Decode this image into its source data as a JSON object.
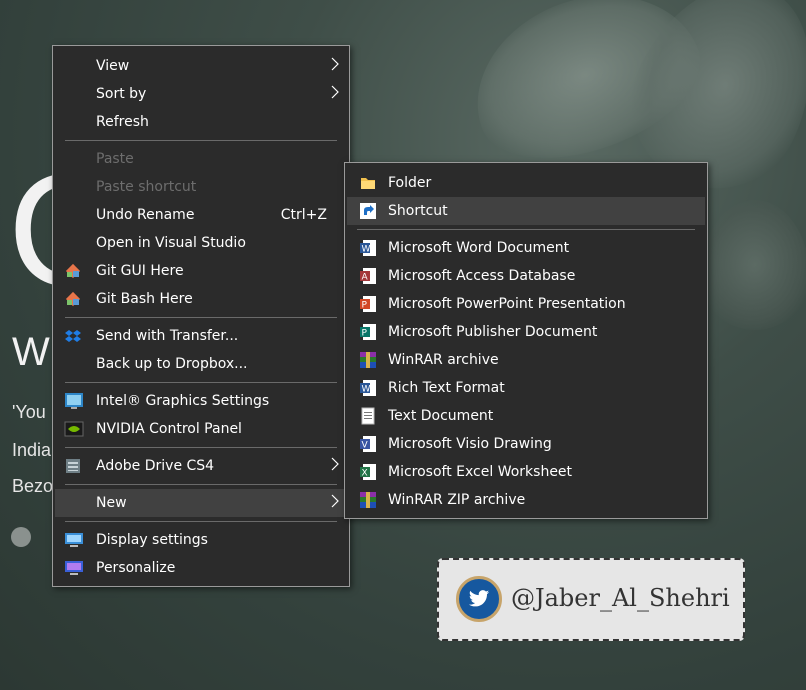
{
  "background": {
    "big_char": "O",
    "heading": "W",
    "lines": [
      "'You",
      "India",
      "Bezo"
    ]
  },
  "context_menu": {
    "items": [
      {
        "label": "View",
        "has_submenu": true
      },
      {
        "label": "Sort by",
        "has_submenu": true
      },
      {
        "label": "Refresh"
      },
      {
        "label": "Paste",
        "disabled": true
      },
      {
        "label": "Paste shortcut",
        "disabled": true
      },
      {
        "label": "Undo Rename",
        "accel": "Ctrl+Z"
      },
      {
        "label": "Open in Visual Studio"
      },
      {
        "label": "Git GUI Here",
        "icon": "git-gui-icon"
      },
      {
        "label": "Git Bash Here",
        "icon": "git-bash-icon"
      },
      {
        "label": "Send with Transfer...",
        "icon": "dropbox-icon"
      },
      {
        "label": "Back up to Dropbox..."
      },
      {
        "label": "Intel® Graphics Settings",
        "icon": "intel-graphics-icon"
      },
      {
        "label": "NVIDIA Control Panel",
        "icon": "nvidia-icon"
      },
      {
        "label": "Adobe Drive CS4",
        "icon": "adobe-drive-icon",
        "has_submenu": true
      },
      {
        "label": "New",
        "has_submenu": true,
        "highlighted": true
      },
      {
        "label": "Display settings",
        "icon": "display-icon"
      },
      {
        "label": "Personalize",
        "icon": "personalize-icon"
      }
    ]
  },
  "new_submenu": {
    "items": [
      {
        "label": "Folder",
        "icon": "folder-icon"
      },
      {
        "label": "Shortcut",
        "icon": "shortcut-icon",
        "highlighted": true
      },
      {
        "label": "Microsoft Word Document",
        "icon": "word-icon"
      },
      {
        "label": "Microsoft Access Database",
        "icon": "access-icon"
      },
      {
        "label": "Microsoft PowerPoint Presentation",
        "icon": "powerpoint-icon"
      },
      {
        "label": "Microsoft Publisher Document",
        "icon": "publisher-icon"
      },
      {
        "label": "WinRAR archive",
        "icon": "winrar-icon"
      },
      {
        "label": "Rich Text Format",
        "icon": "rtf-icon"
      },
      {
        "label": "Text Document",
        "icon": "text-document-icon"
      },
      {
        "label": "Microsoft Visio Drawing",
        "icon": "visio-icon"
      },
      {
        "label": "Microsoft Excel Worksheet",
        "icon": "excel-icon"
      },
      {
        "label": "WinRAR ZIP archive",
        "icon": "winrar-zip-icon"
      }
    ]
  },
  "watermark": {
    "handle": "@Jaber_Al_Shehri",
    "icon": "twitter-icon"
  },
  "colors": {
    "menu_bg": "#2b2b2b",
    "menu_highlight": "#414141",
    "disabled_text": "#6d6d6d",
    "twitter_blue": "#16589f"
  }
}
